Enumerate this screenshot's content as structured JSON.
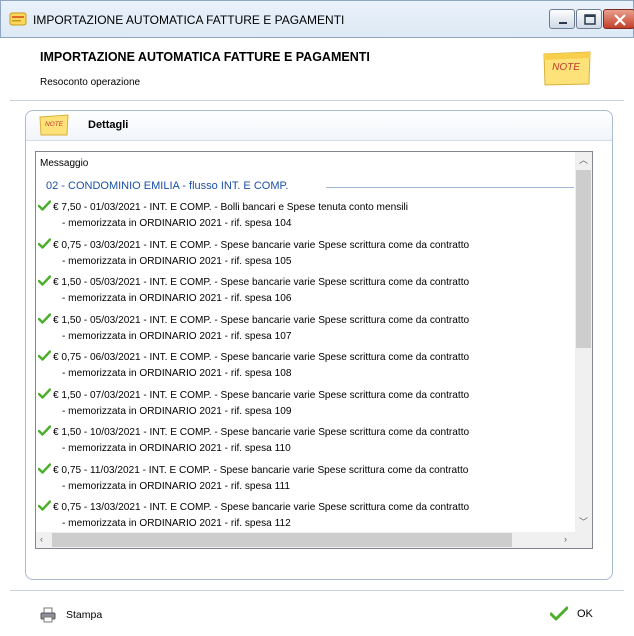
{
  "window": {
    "title": "IMPORTAZIONE AUTOMATICA FATTURE E PAGAMENTI"
  },
  "header": {
    "title": "IMPORTAZIONE AUTOMATICA FATTURE E PAGAMENTI",
    "subtitle": "Resoconto operazione",
    "note_text": "NOTE"
  },
  "panel": {
    "title": "Dettagli",
    "note_text": "NOTE"
  },
  "list": {
    "column_header": "Messaggio",
    "group_label": "02 - CONDOMINIO EMILIA - flusso INT. E COMP.",
    "items": [
      {
        "line1": "€ 7,50 - 01/03/2021 - INT. E COMP. - Bolli bancari e Spese tenuta conto mensili",
        "line2": "- memorizzata in ORDINARIO 2021 - rif. spesa 104"
      },
      {
        "line1": "€ 0,75 - 03/03/2021 - INT. E COMP. - Spese bancarie varie Spese scrittura come da contratto",
        "line2": "- memorizzata in ORDINARIO 2021 - rif. spesa 105"
      },
      {
        "line1": "€ 1,50 - 05/03/2021 - INT. E COMP. - Spese bancarie varie Spese scrittura come da contratto",
        "line2": "- memorizzata in ORDINARIO 2021 - rif. spesa 106"
      },
      {
        "line1": "€ 1,50 - 05/03/2021 - INT. E COMP. - Spese bancarie varie Spese scrittura come da contratto",
        "line2": "- memorizzata in ORDINARIO 2021 - rif. spesa 107"
      },
      {
        "line1": "€ 0,75 - 06/03/2021 - INT. E COMP. - Spese bancarie varie Spese scrittura come da contratto",
        "line2": "- memorizzata in ORDINARIO 2021 - rif. spesa 108"
      },
      {
        "line1": "€ 1,50 - 07/03/2021 - INT. E COMP. - Spese bancarie varie Spese scrittura come da contratto",
        "line2": "- memorizzata in ORDINARIO 2021 - rif. spesa 109"
      },
      {
        "line1": "€ 1,50 - 10/03/2021 - INT. E COMP. - Spese bancarie varie Spese scrittura come da contratto",
        "line2": "- memorizzata in ORDINARIO 2021 - rif. spesa 110"
      },
      {
        "line1": "€ 0,75 - 11/03/2021 - INT. E COMP. - Spese bancarie varie Spese scrittura come da contratto",
        "line2": "- memorizzata in ORDINARIO 2021 - rif. spesa 111"
      },
      {
        "line1": "€ 0,75 - 13/03/2021 - INT. E COMP. - Spese bancarie varie Spese scrittura come da contratto",
        "line2": "- memorizzata in ORDINARIO 2021 - rif. spesa 112"
      }
    ]
  },
  "footer": {
    "print_label": "Stampa",
    "ok_label": "OK"
  },
  "colors": {
    "group_text": "#1b50a8",
    "check_green": "#4caf2a",
    "note_yellow": "#fde27a"
  },
  "icons": {
    "title": "note-app-icon",
    "check": "green-check-icon",
    "print": "printer-icon",
    "ok": "green-check-icon"
  }
}
